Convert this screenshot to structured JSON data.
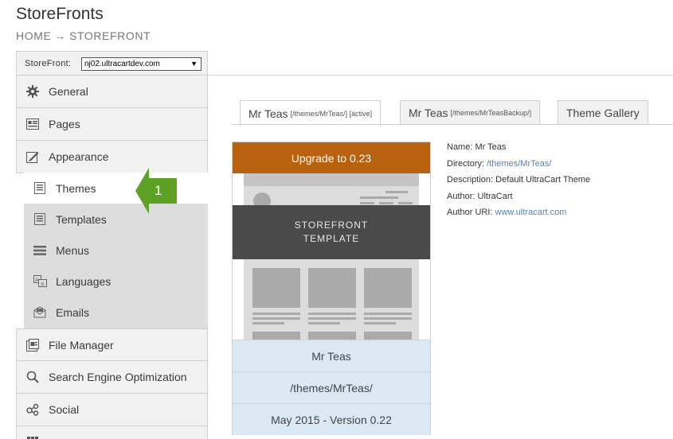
{
  "header": {
    "title": "StoreFronts",
    "breadcrumb": [
      "HOME",
      "STOREFRONT"
    ],
    "breadcrumb_separator": "→"
  },
  "storefront_selector": {
    "label": "StoreFront:",
    "selected": "nj02.ultracartdev.com"
  },
  "sidebar": {
    "items": [
      {
        "label": "General",
        "icon": "gear-icon"
      },
      {
        "label": "Pages",
        "icon": "pages-icon"
      },
      {
        "label": "Appearance",
        "icon": "appearance-icon"
      }
    ],
    "subitems": [
      {
        "label": "Themes",
        "icon": "themes-icon",
        "active": true
      },
      {
        "label": "Templates",
        "icon": "templates-icon"
      },
      {
        "label": "Menus",
        "icon": "menus-icon"
      },
      {
        "label": "Languages",
        "icon": "languages-icon"
      },
      {
        "label": "Emails",
        "icon": "emails-icon"
      }
    ],
    "items_after": [
      {
        "label": "File Manager",
        "icon": "file-manager-icon"
      },
      {
        "label": "Search Engine Optimization",
        "icon": "search-icon"
      },
      {
        "label": "Social",
        "icon": "social-icon"
      }
    ]
  },
  "callout": {
    "number": "1",
    "color": "#5ea225"
  },
  "tabs": [
    {
      "label": "Mr Teas",
      "path": "[/themes/MrTeas/] [active]",
      "active": true
    },
    {
      "label": "Mr Teas",
      "path": "[/themes/MrTeasBackup/]",
      "active": false
    },
    {
      "label": "Theme Gallery",
      "path": "",
      "active": false
    }
  ],
  "theme_card": {
    "upgrade_label": "Upgrade to 0.23",
    "preview_overlay_line1": "STOREFRONT",
    "preview_overlay_line2": "TEMPLATE",
    "name": "Mr Teas",
    "directory": "/themes/MrTeas/",
    "version": "May 2015 - Version 0.22"
  },
  "details": {
    "name_label": "Name:",
    "name_value": "Mr Teas",
    "directory_label": "Directory:",
    "directory_value": "/themes/MrTeas/",
    "description_label": "Description:",
    "description_value": "Default UltraCart Theme",
    "author_label": "Author:",
    "author_value": "UltraCart",
    "author_uri_label": "Author URI:",
    "author_uri_value": "www.ultracart.com"
  },
  "colors": {
    "upgrade": "#b8620f",
    "callout": "#5ea225",
    "link": "#5b7fa6"
  }
}
